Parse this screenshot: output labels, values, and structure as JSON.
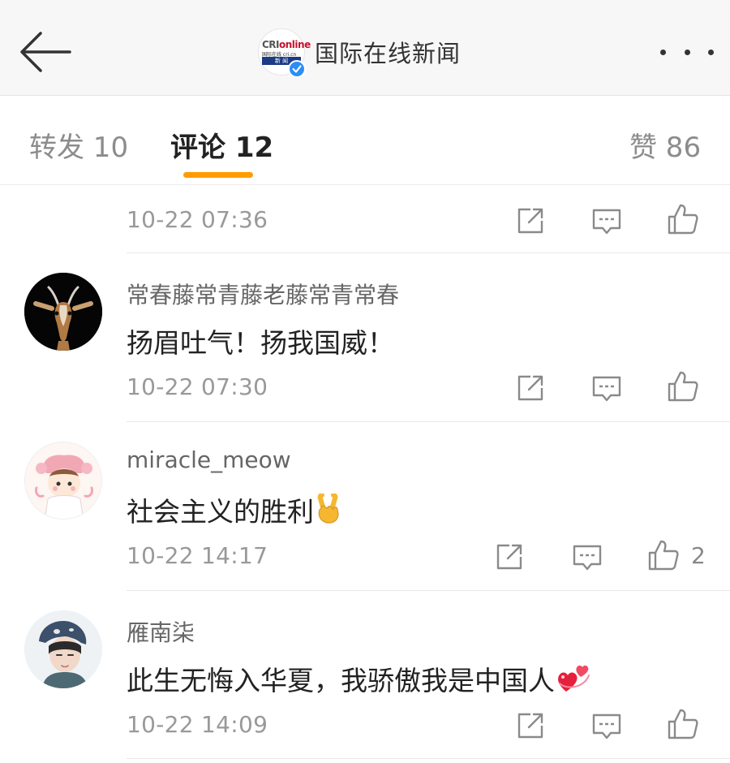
{
  "header": {
    "title": "国际在线新闻",
    "logo_text_cri": "CRI",
    "logo_text_online": "online",
    "logo_text_sub": "国际在线 cri.cn",
    "logo_text_bar": "新 闻"
  },
  "tabs": {
    "repost": "转发 10",
    "comments": "评论 12",
    "likes": "赞 86"
  },
  "comments": [
    {
      "time": "10-22 07:36"
    },
    {
      "username": "常春藤常青藤老藤常青常春",
      "content": "扬眉吐气！扬我国威！",
      "time": "10-22 07:30"
    },
    {
      "username": "miracle_meow",
      "content": "社会主义的胜利",
      "time": "10-22 14:17",
      "likes": "2"
    },
    {
      "username": "雁南柒",
      "content": "此生无悔入华夏，我骄傲我是中国人",
      "time": "10-22 14:09"
    }
  ],
  "colors": {
    "accent": "#ff9c00",
    "verified": "#2c8df5",
    "icon": "#8a8a8a"
  }
}
